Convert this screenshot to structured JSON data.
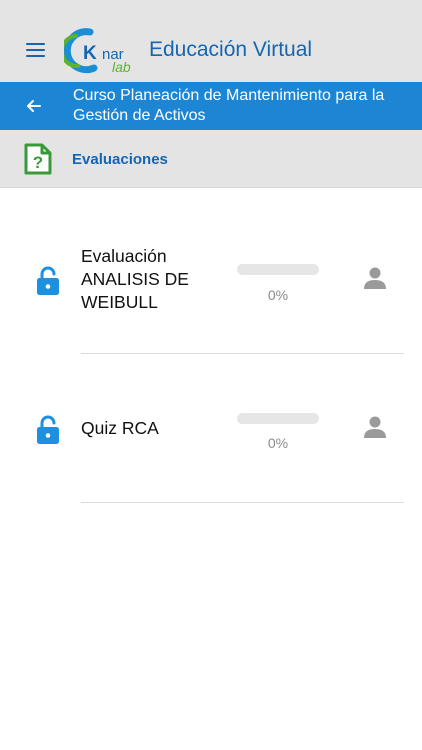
{
  "header": {
    "app_title": "Educación Virtual",
    "logo_text_top": "nar",
    "logo_text_bottom": "lab",
    "logo_letter": "K",
    "menu_icon": "hamburger-menu-icon"
  },
  "course": {
    "title": "Curso Planeación de Mantenimiento para la Gestión de Activos",
    "back_icon": "arrow-left-icon"
  },
  "section": {
    "title": "Evaluaciones",
    "icon": "question-document-icon"
  },
  "evaluations": [
    {
      "title": "Evaluación ANALISIS DE WEIBULL",
      "progress": 0,
      "progress_label": "0%",
      "status_icon": "lock-open-icon",
      "user_icon": "person-icon"
    },
    {
      "title": "Quiz RCA",
      "progress": 0,
      "progress_label": "0%",
      "status_icon": "lock-open-icon",
      "user_icon": "person-icon"
    }
  ],
  "colors": {
    "primary_blue": "#1466b3",
    "course_bar": "#1c86d4",
    "header_bg": "#e4e4e4",
    "lock_blue": "#1e90e0",
    "logo_green": "#5cb22e"
  }
}
